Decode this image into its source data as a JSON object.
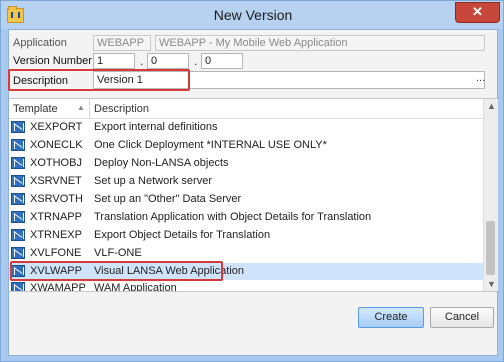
{
  "window": {
    "title": "New Version",
    "close_label": "✕"
  },
  "form": {
    "application_label": "Application",
    "application_value": "WEBAPP",
    "application_desc": "WEBAPP - My Mobile Web Application",
    "version_label": "Version Number",
    "version_major": "1",
    "version_minor": "0",
    "version_patch": "0",
    "version_sep": ".",
    "description_label": "Description",
    "description_value": "Version 1",
    "ellipsis": "..."
  },
  "grid": {
    "columns": [
      "Template",
      "Description"
    ],
    "sort_indicator": "▲",
    "rows": [
      {
        "template": "XEXPORT",
        "description": "Export internal definitions"
      },
      {
        "template": "XONECLK",
        "description": "One Click Deployment *INTERNAL USE ONLY*"
      },
      {
        "template": "XOTHOBJ",
        "description": "Deploy Non-LANSA objects"
      },
      {
        "template": "XSRVNET",
        "description": "Set up a Network server"
      },
      {
        "template": "XSRVOTH",
        "description": "Set up an \"Other\" Data Server"
      },
      {
        "template": "XTRNAPP",
        "description": "Translation Application with Object Details for Translation"
      },
      {
        "template": "XTRNEXP",
        "description": "Export Object Details for Translation"
      },
      {
        "template": "XVLFONE",
        "description": "VLF-ONE"
      },
      {
        "template": "XVLWAPP",
        "description": "Visual LANSA Web Application"
      },
      {
        "template": "XWAMAPP",
        "description": "WAM Application"
      }
    ],
    "selected_index": 8,
    "scroll_up": "▲",
    "scroll_down": "▼"
  },
  "buttons": {
    "create": "Create",
    "cancel": "Cancel"
  },
  "colors": {
    "highlight": "#d63a3a",
    "selection": "#cfe3fb",
    "primary": "#a6cdf6"
  }
}
